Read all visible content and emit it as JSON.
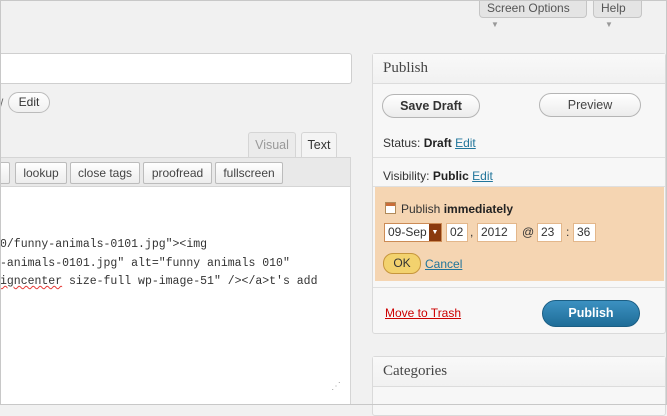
{
  "meta_links": {
    "screen_options": "Screen Options",
    "help": "Help"
  },
  "slug": {
    "prefix": "/",
    "edit_label": "Edit"
  },
  "editor": {
    "tabs": {
      "visual": "Visual",
      "text": "Text"
    },
    "quicktags": [
      "lookup",
      "close tags",
      "proofread",
      "fullscreen"
    ],
    "lines": [
      "0/funny-animals-0101.jpg\"><img",
      "-animals-0101.jpg\" alt=\"funny animals 010\""
    ],
    "line3_misspelled": "igncenter",
    "line3_rest": " size-full wp-image-51\" /></a>t's add"
  },
  "publish_box": {
    "title": "Publish",
    "save_draft": "Save Draft",
    "preview": "Preview",
    "status_label": "Status:",
    "status_value": "Draft",
    "status_edit": "Edit",
    "visibility_label": "Visibility:",
    "visibility_value": "Public",
    "visibility_edit": "Edit",
    "schedule_label": "Publish",
    "schedule_value": "immediately",
    "month": "09-Sep",
    "day": "02",
    "year": "2012",
    "at": "@",
    "hour": "23",
    "minute": "36",
    "comma": ",",
    "colon": ":",
    "ok": "OK",
    "cancel": "Cancel",
    "move_to_trash": "Move to Trash",
    "publish": "Publish"
  },
  "categories_box": {
    "title": "Categories"
  },
  "colors": {
    "schedule_highlight": "#f5d5b2",
    "publish_button": "#21759b",
    "link": "#21759b",
    "trash": "#cc0000"
  }
}
